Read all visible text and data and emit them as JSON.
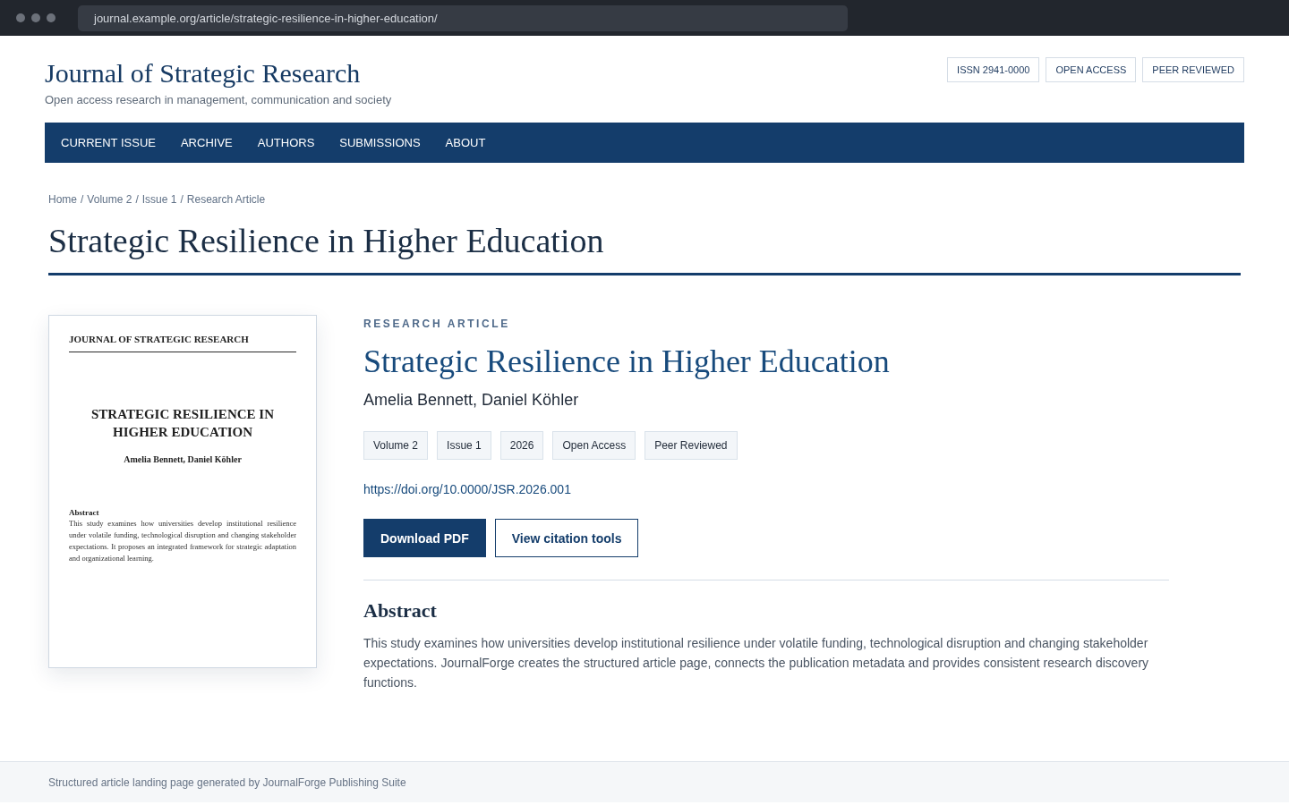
{
  "browser": {
    "url": "journal.example.org/article/strategic-resilience-in-higher-education/"
  },
  "header": {
    "title": "Journal of Strategic Research",
    "tagline": "Open access research in management, communication and society",
    "badges": [
      "ISSN 2941-0000",
      "OPEN ACCESS",
      "PEER REVIEWED"
    ]
  },
  "nav": {
    "items": [
      "CURRENT ISSUE",
      "ARCHIVE",
      "AUTHORS",
      "SUBMISSIONS",
      "ABOUT"
    ]
  },
  "breadcrumb": {
    "items": [
      "Home",
      "Volume 2",
      "Issue 1",
      "Research Article"
    ],
    "separator": "/"
  },
  "page_title": "Strategic Resilience in Higher Education",
  "cover": {
    "journal": "JOURNAL OF STRATEGIC RESEARCH",
    "title": "STRATEGIC RESILIENCE IN HIGHER EDUCATION",
    "authors": "Amelia Bennett, Daniel Köhler",
    "abstract_heading": "Abstract",
    "abstract": "This study examines how universities develop institutional resilience under volatile funding, technological disruption and changing stakeholder expectations. It proposes an integrated framework for strategic adaptation and organizational learning."
  },
  "article": {
    "type_label": "RESEARCH ARTICLE",
    "title": "Strategic Resilience in Higher Education",
    "authors": "Amelia Bennett, Daniel Köhler",
    "tags": [
      "Volume 2",
      "Issue 1",
      "2026",
      "Open Access",
      "Peer Reviewed"
    ],
    "doi": "https://doi.org/10.0000/JSR.2026.001",
    "buttons": [
      {
        "label": "Download PDF",
        "kind": "primary"
      },
      {
        "label": "View citation tools",
        "kind": "secondary"
      }
    ],
    "abstract": {
      "heading": "Abstract",
      "text": "This study examines how universities develop institutional resilience under volatile funding, technological disruption and changing stakeholder expectations. JournalForge creates the structured article page, connects the publication metadata and provides consistent research discovery functions."
    }
  },
  "footer": {
    "text": "Structured article landing page generated by JournalForge Publishing Suite"
  }
}
